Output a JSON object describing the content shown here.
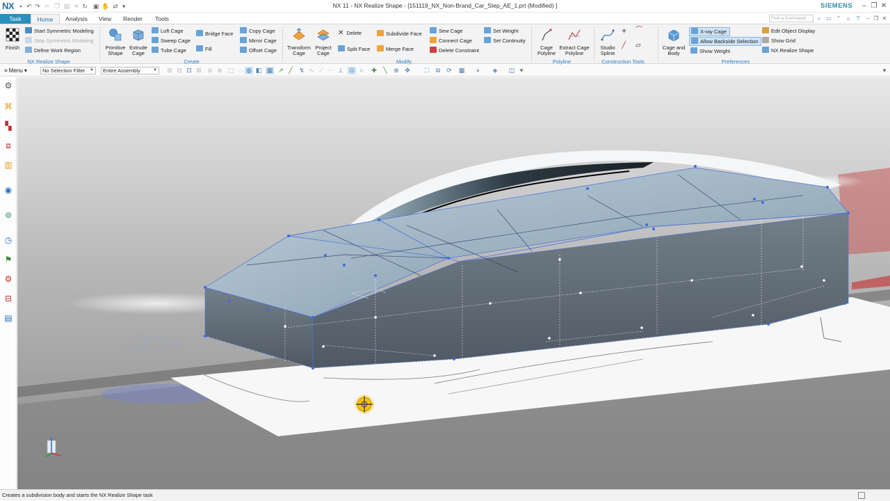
{
  "app": {
    "logo": "NX",
    "window_title": "NX 11 - NX Realize Shape - [151119_NX_Non-Brand_Car_Step_AE_1.prt (Modified) ]",
    "brand": "SIEMENS"
  },
  "tabs": {
    "task": "Task",
    "home": "Home",
    "analysis": "Analysis",
    "view": "View",
    "render": "Render",
    "tools": "Tools"
  },
  "command_finder": {
    "placeholder": "Find a Command"
  },
  "ribbon": {
    "finish": "Finish",
    "start_symmetric": "Start Symmetric Modeling",
    "stop_symmetric": "Stop Symmetric Modeling",
    "define_work_region": "Define Work Region",
    "group_nx_realize_shape": "NX Realize Shape",
    "primitive_shape": [
      "Primitive",
      "Shape"
    ],
    "extrude_cage": [
      "Extrude",
      "Cage"
    ],
    "loft_cage": "Loft Cage",
    "sweep_cage": "Sweep Cage",
    "tube_cage": "Tube Cage",
    "bridge_face": "Bridge Face",
    "fill": "Fill",
    "copy_cage": "Copy Cage",
    "mirror_cage": "Mirror Cage",
    "offset_cage": "Offset Cage",
    "group_create": "Create",
    "transform_cage": [
      "Transform",
      "Cage"
    ],
    "project_cage": [
      "Project",
      "Cage"
    ],
    "delete": "Delete",
    "split_face": "Split Face",
    "subdivide_face": "Subdivide Face",
    "merge_face": "Merge Face",
    "sew_cage": "Sew Cage",
    "connect_cage": "Connect Cage",
    "delete_constraint": "Delete Constraint",
    "set_weight": "Set Weight",
    "set_continuity": "Set Continuity",
    "group_modify": "Modify",
    "cage_polyline": [
      "Cage",
      "Polyline"
    ],
    "extract_cage_polyline": [
      "Extract Cage",
      "Polyline"
    ],
    "group_polyline": "Polyline",
    "studio_spline": [
      "Studio",
      "Spline"
    ],
    "group_construction_tools": "Construction Tools",
    "cage_and_body": [
      "Cage and",
      "Body"
    ],
    "xray_cage": "X-ray Cage",
    "allow_backside_selection": "Allow Backside Selection",
    "show_weight": "Show Weight",
    "edit_object_display": "Edit Object Display",
    "show_grid": "Show Grid",
    "nx_realize_shape_pref": "NX Realize Shape",
    "group_preferences": "Preferences"
  },
  "selection_bar": {
    "menu": "Menu",
    "filter": "No Selection Filter",
    "scope": "Entire Assembly"
  },
  "status": {
    "text": "Creates a subdivision body and starts the NX Realize Shape task"
  },
  "icons": [
    "quick-access-icons",
    "ribbon-icons",
    "resource-bar-icons",
    "wcs-triad-icon",
    "snap-cursor-icon"
  ],
  "colors": {
    "accent": "#2a8fbd",
    "cage": "#4a70d8",
    "body": "#6f8a9e",
    "cursor": "#f5c400"
  }
}
